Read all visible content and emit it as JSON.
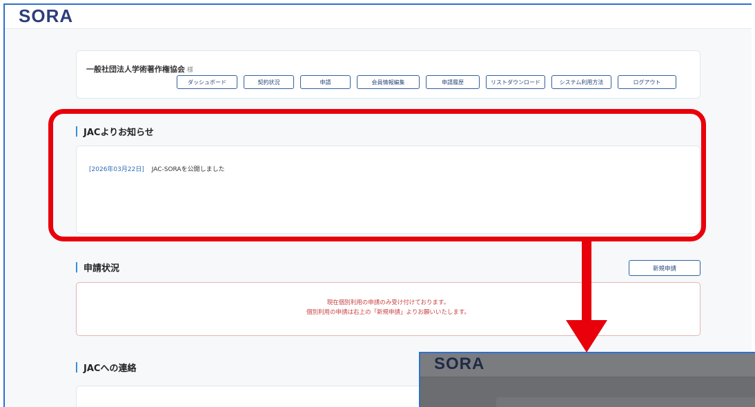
{
  "header": {
    "logo_text": "SORA"
  },
  "member": {
    "name": "一般社団法人学術著作権協会",
    "honorific": "様"
  },
  "nav": {
    "items": [
      {
        "label": "ダッシュボード"
      },
      {
        "label": "契約状況"
      },
      {
        "label": "申請"
      },
      {
        "label": "会員情報編集"
      },
      {
        "label": "申請履歴"
      },
      {
        "label": "リストダウンロード"
      },
      {
        "label": "システム利用方法"
      },
      {
        "label": "ログアウト"
      }
    ]
  },
  "notices": {
    "title": "JACよりお知らせ",
    "items": [
      {
        "date": "[2026年03月22日]",
        "text": "JAC-SORAを公開しました"
      }
    ]
  },
  "application_status": {
    "title": "申請状況",
    "new_button_label": "新規申請",
    "message_line1": "現在個別利用の申請のみ受け付けております。",
    "message_line2": "個別利用の申請は右上の「新規申請」よりお願いいたします。"
  },
  "contact": {
    "title": "JACへの連絡"
  },
  "overlay": {
    "logo_text": "SORA"
  },
  "colors": {
    "accent": "#3a8fd8",
    "highlight": "#e8000b",
    "notice_date": "#2d6ab5",
    "status_text": "#c94040"
  }
}
